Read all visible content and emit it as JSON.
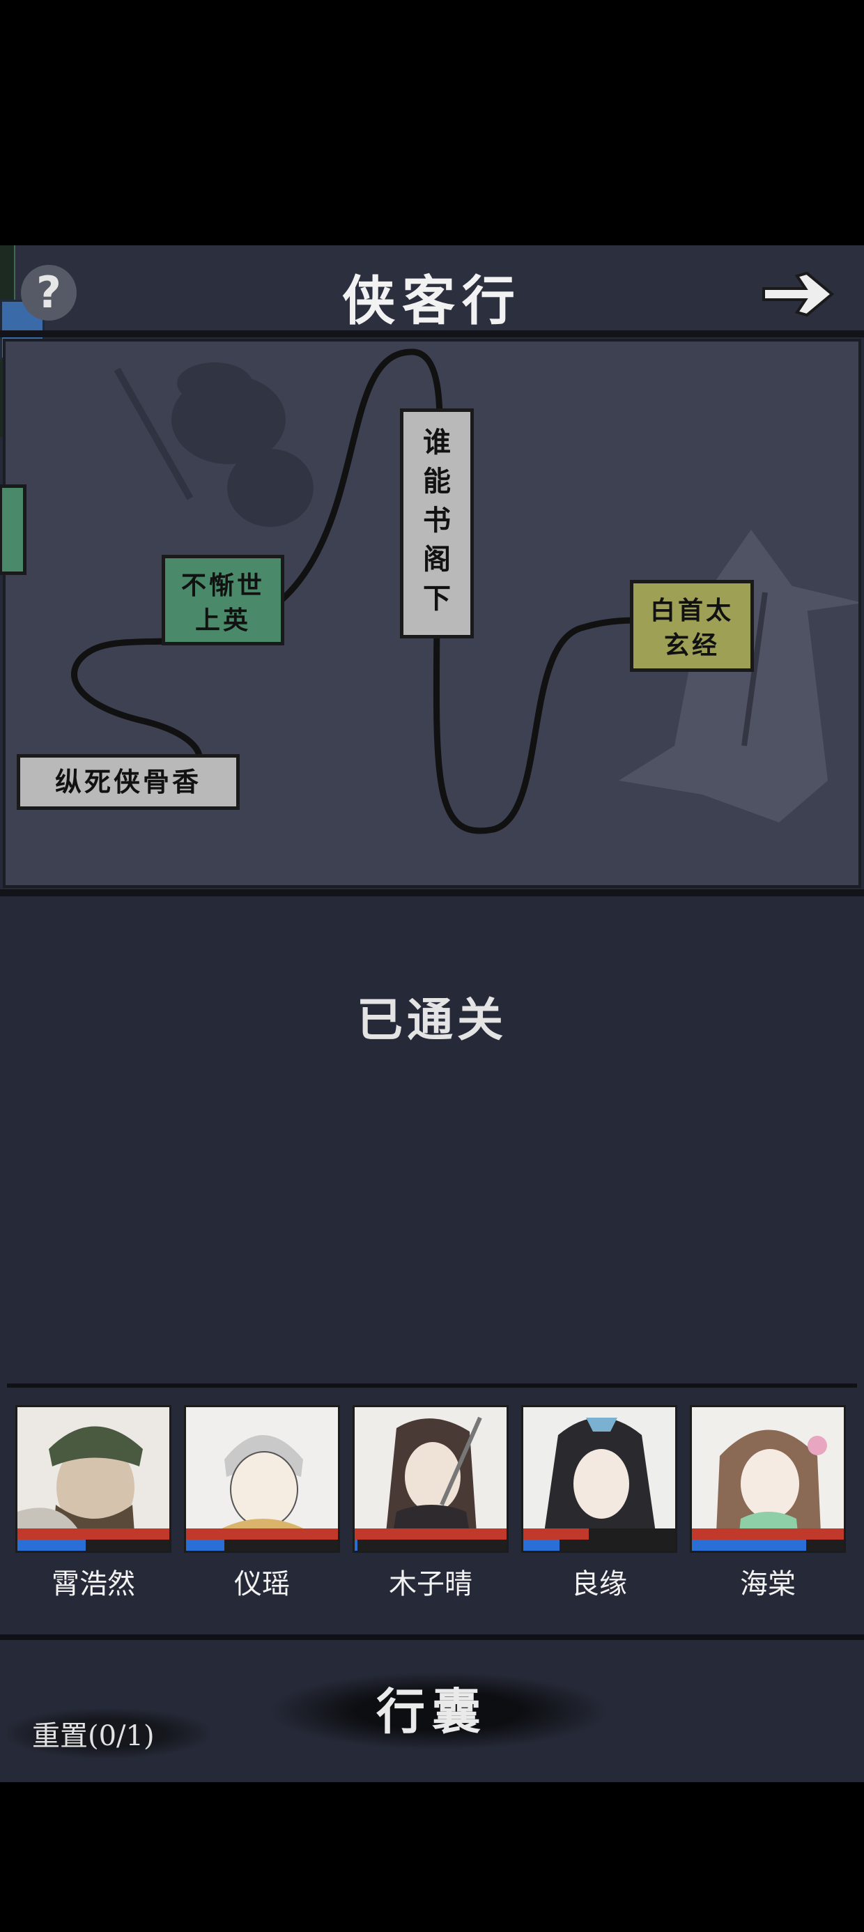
{
  "header": {
    "title": "侠客行",
    "help_label": "?"
  },
  "map": {
    "nodes": [
      {
        "id": "node-1",
        "label": "纵死侠骨香",
        "color": "#b9b9b9"
      },
      {
        "id": "node-2",
        "label": "不惭世上英",
        "color": "#4a8a6a"
      },
      {
        "id": "node-3",
        "label": "谁能书阁下",
        "color": "#b9b9b9"
      },
      {
        "id": "node-4",
        "label": "白首太玄经",
        "color": "#9da055"
      }
    ]
  },
  "status": "已通关",
  "party": [
    {
      "name": "霄浩然",
      "hp": 1.0,
      "mp": 0.45
    },
    {
      "name": "仪瑶",
      "hp": 1.0,
      "mp": 0.25
    },
    {
      "name": "木子晴",
      "hp": 1.0,
      "mp": 0.02
    },
    {
      "name": "良缘",
      "hp": 0.43,
      "mp": 0.24
    },
    {
      "name": "海棠",
      "hp": 1.0,
      "mp": 0.75
    }
  ],
  "footer": {
    "bag_label": "行囊",
    "reset_label": "重置(0/1)"
  }
}
